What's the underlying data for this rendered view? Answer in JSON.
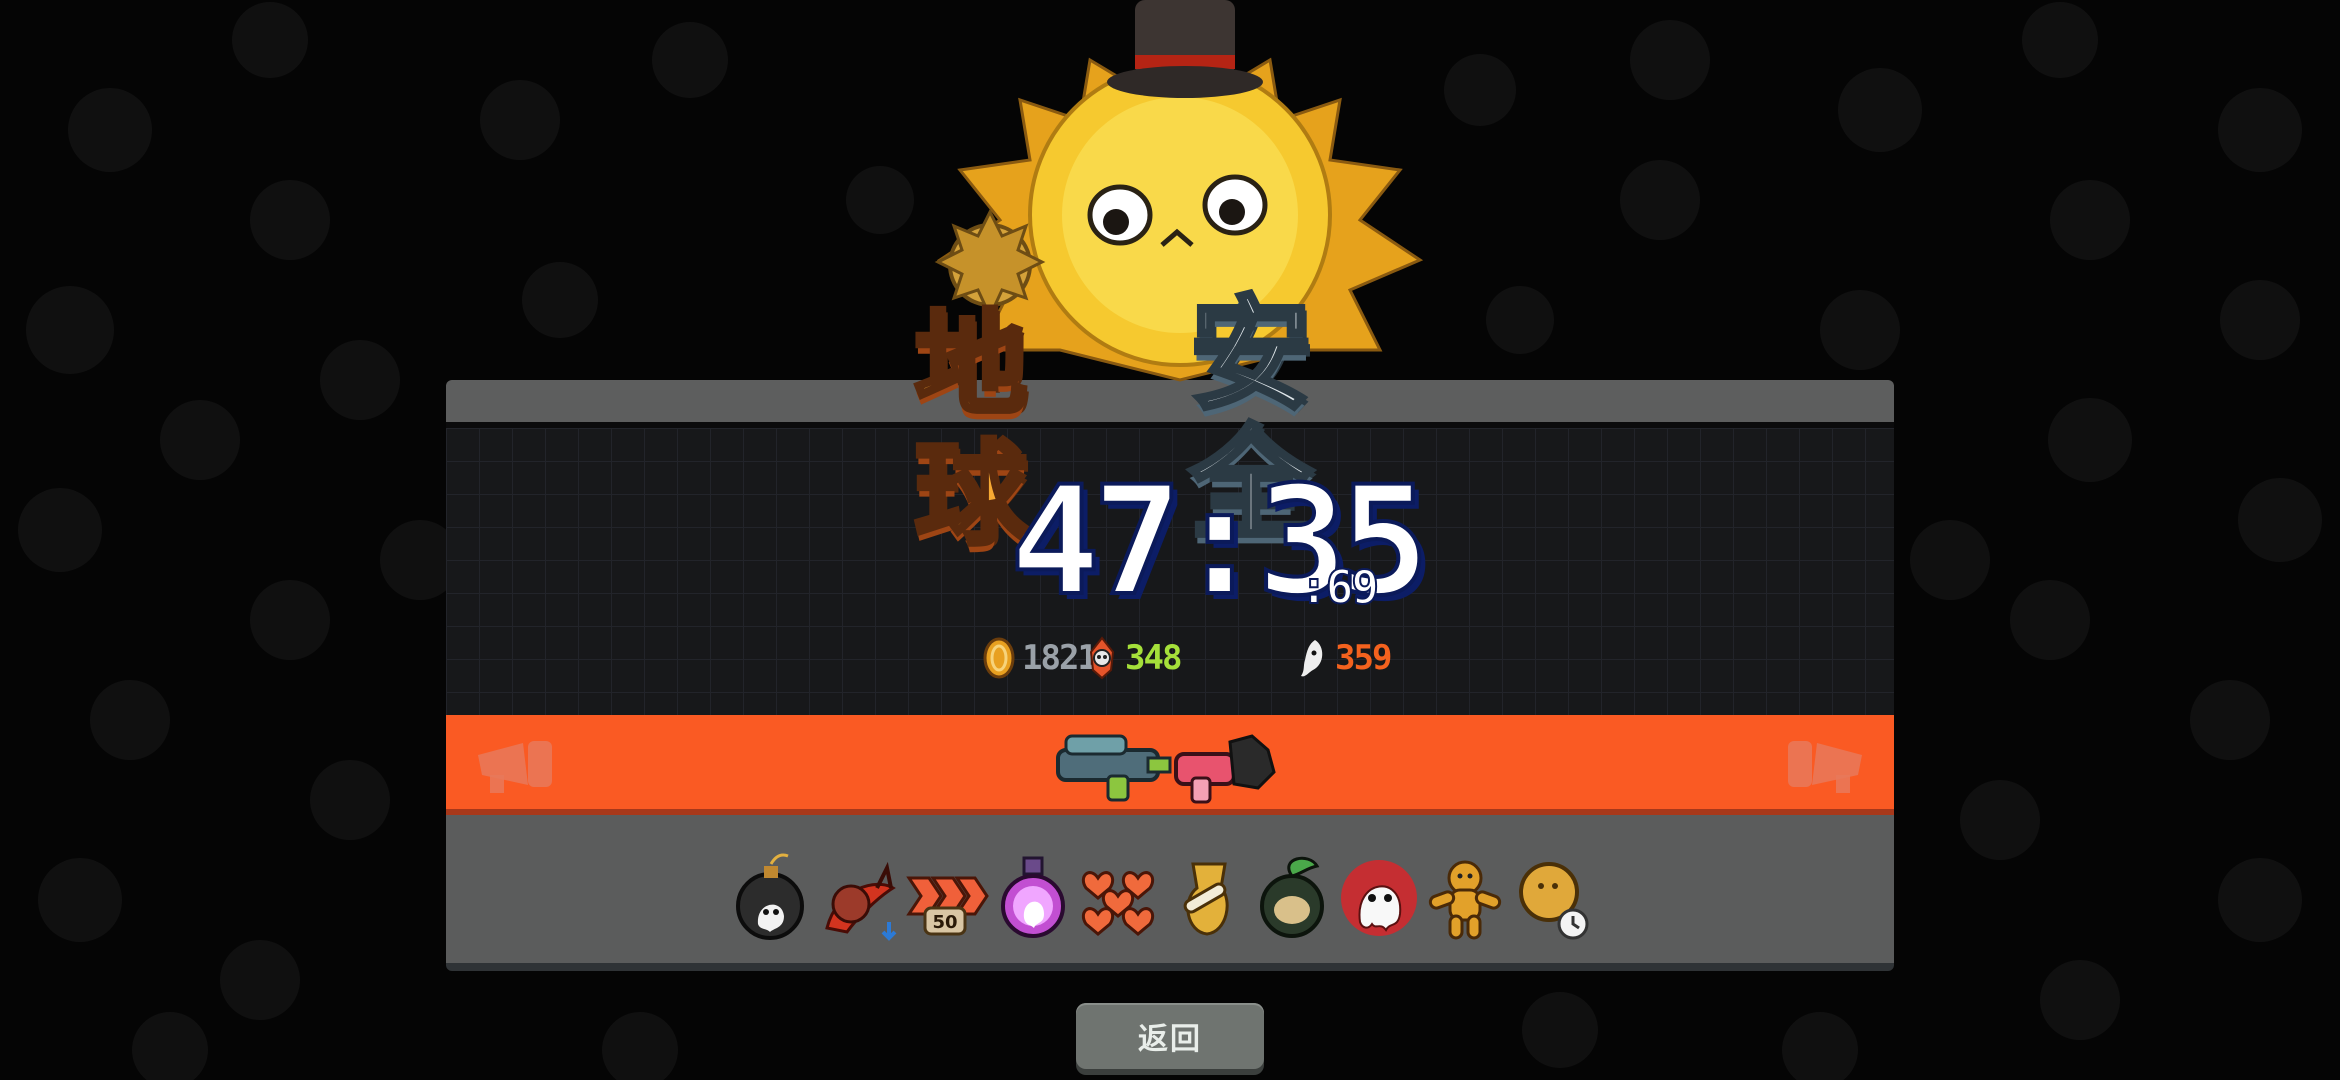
{
  "banner": {
    "title_part1": "地球",
    "title_part2": "安全"
  },
  "timer": {
    "main": "47:35",
    "ms": ":69"
  },
  "stats": {
    "coins": "1821",
    "kills": "348",
    "souls": "359"
  },
  "weapons": [
    "rocket-launcher-icon",
    "chainsaw-gun-icon"
  ],
  "items": [
    "ghost-bomb-icon",
    "snail-chili-icon",
    "speed-arrows-50-icon",
    "ghost-potion-icon",
    "hearts-cluster-icon",
    "bone-gourd-icon",
    "dark-fruit-icon",
    "ghost-flame-icon",
    "gingerbread-man-icon",
    "cookie-timer-icon"
  ],
  "items_badge": "50",
  "back_button": {
    "label": "返回"
  },
  "colors": {
    "accent": "#fa5a23",
    "panel_dark": "#17181a",
    "panel_gray": "#5b5c5c",
    "coin": "#9aa1a8",
    "kills": "#a5e03a",
    "souls": "#f4621e"
  }
}
